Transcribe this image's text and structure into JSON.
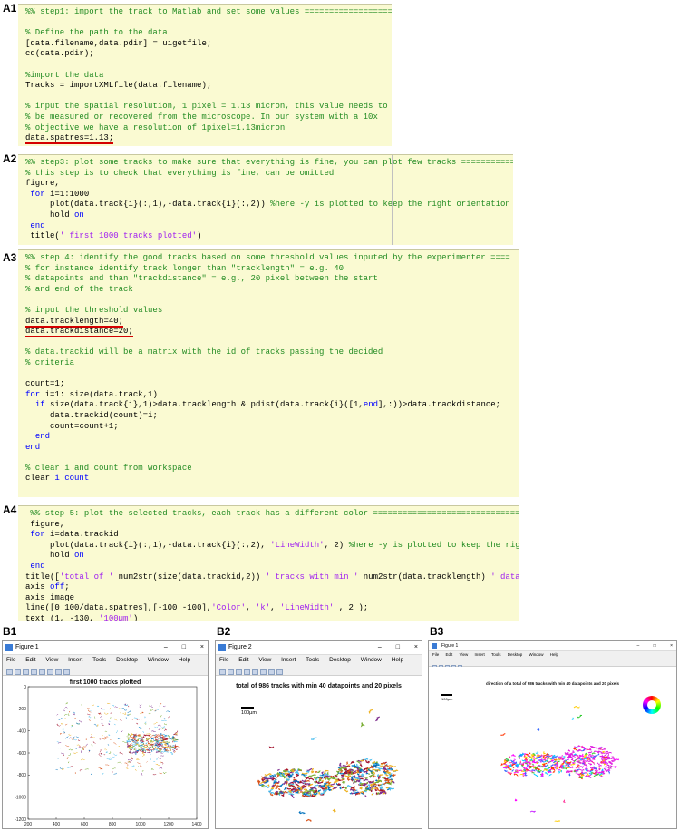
{
  "panels": {
    "a1": "A1",
    "a2": "A2",
    "a3": "A3",
    "a4": "A4",
    "b1": "B1",
    "b2": "B2",
    "b3": "B3"
  },
  "code": {
    "a1": [
      "%% step1: import the track to Matlab and set some values ==================",
      "",
      "% Define the path to the data",
      "[data.filename,data.pdir] = uigetfile;",
      "cd(data.pdir);",
      "",
      "%import the data",
      "Tracks = importXMLfile(data.filename);",
      "",
      "% input the spatial resolution, 1 pixel = 1.13 micron, this value needs to",
      "% be measured or recovered from the microscope. In our system with a 10x",
      "% objective we have a resolution of 1pixel=1.13micron",
      "data.spatres=1.13;"
    ],
    "a2": [
      "%% step3: plot some tracks to make sure that everything is fine, you can plot few tracks ===========",
      "% this step is to check that everything is fine, can be omitted",
      "figure,",
      " for i=1:1000",
      "     plot(data.track{i}(:,1),-data.track{i}(:,2)) %here -y is plotted to keep the right orientation",
      "     hold on",
      " end",
      " title(' first 1000 tracks plotted')"
    ],
    "a3": [
      "%% step 4: identify the good tracks based on some threshold values inputed by the experimenter ====",
      "% for instance identify track longer than \"tracklength\" = e.g. 40",
      "% datapoints and than \"trackdistance\" = e.g., 20 pixel between the start",
      "% and end of the track",
      "",
      "% input the threshold values",
      "data.tracklength=40;",
      "data.trackdistance=20;",
      "",
      "% data.trackid will be a matrix with the id of tracks passing the decided",
      "% criteria",
      "",
      "count=1;",
      "for i=1: size(data.track,1)",
      "  if size(data.track{i},1)>data.tracklength & pdist(data.track{i}([1,end],:))>data.trackdistance;",
      "     data.trackid(count)=i;",
      "     count=count+1;",
      "  end",
      "end",
      "",
      "% clear i and count from workspace",
      "clear i count"
    ],
    "a4": [
      " %% step 5: plot the selected tracks, each track has a different color ===============================",
      " figure,",
      " for i=data.trackid",
      "     plot(data.track{i}(:,1),-data.track{i}(:,2), 'LineWidth', 2) %here -y is plotted to keep the right orientation",
      "     hold on",
      " end",
      "title(['total of ' num2str(size(data.trackid,2)) ' tracks with min ' num2str(data.tracklength) ' datapoints and ' :",
      "axis off;",
      "axis image",
      "line([0 100/data.spatres],[-100 -100],'Color', 'k', 'LineWidth' , 2 );",
      "text (1, -130, '100µm')"
    ]
  },
  "figures": {
    "b1": {
      "window_title": "Figure 1",
      "menu": [
        "File",
        "Edit",
        "View",
        "Insert",
        "Tools",
        "Desktop",
        "Window",
        "Help"
      ],
      "plot_title": "first 1000 tracks plotted"
    },
    "b2": {
      "window_title": "Figure 2",
      "menu": [
        "File",
        "Edit",
        "View",
        "Insert",
        "Tools",
        "Desktop",
        "Window",
        "Help"
      ],
      "plot_title": "total of 986 tracks with min 40 datapoints and 20 pixels",
      "scale_label": "100µm"
    },
    "b3": {
      "window_title": "Figure 1",
      "menu": [
        "File",
        "Edit",
        "View",
        "Insert",
        "Tools",
        "Desktop",
        "Window",
        "Help"
      ],
      "plot_title": "direction of a total of 986 tracks with min 40 datapoints and 20 pixels",
      "scale_label": "100µm"
    },
    "window_controls": [
      "–",
      "□",
      "×"
    ]
  },
  "chart_data": {
    "type": "scatter",
    "title": "first 1000 tracks plotted",
    "xlim": [
      200,
      1400
    ],
    "ylim": [
      -1200,
      0
    ],
    "xticks": [
      200,
      400,
      600,
      800,
      1000,
      1200,
      1400
    ],
    "yticks": [
      0,
      -200,
      -400,
      -600,
      -800,
      -1000,
      -1200
    ],
    "grid": false
  },
  "colors": {
    "code_bg": "#fafad2",
    "comment": "#228b22",
    "keyword": "#0000ff",
    "string": "#a020f0",
    "underline": "#d40000"
  }
}
